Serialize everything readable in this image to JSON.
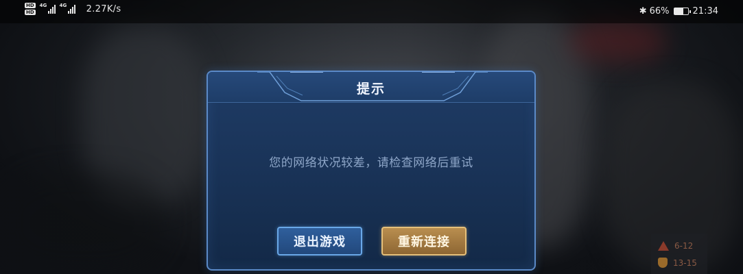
{
  "status_bar": {
    "hd_badges": [
      "HD",
      "HD"
    ],
    "signal_labels": [
      "4G",
      "4G"
    ],
    "net_speed": "2.27K/s",
    "bluetooth_icon": "bluetooth-icon",
    "battery_percent": "66%",
    "battery_level": 0.66,
    "time": "21:34"
  },
  "dialog": {
    "title": "提示",
    "message": "您的网络状况较差，请检查网络后重试",
    "exit_label": "退出游戏",
    "reconnect_label": "重新连接"
  },
  "rank_panel": {
    "rows": [
      {
        "icon": "warning-icon",
        "text": "6-12"
      },
      {
        "icon": "shield-icon",
        "text": "13-15"
      }
    ]
  },
  "colors": {
    "dialog_border": "#5b8ac8",
    "dialog_bg": "#1a3459",
    "exit_button": "#22487c",
    "reconnect_button": "#8d6633"
  }
}
